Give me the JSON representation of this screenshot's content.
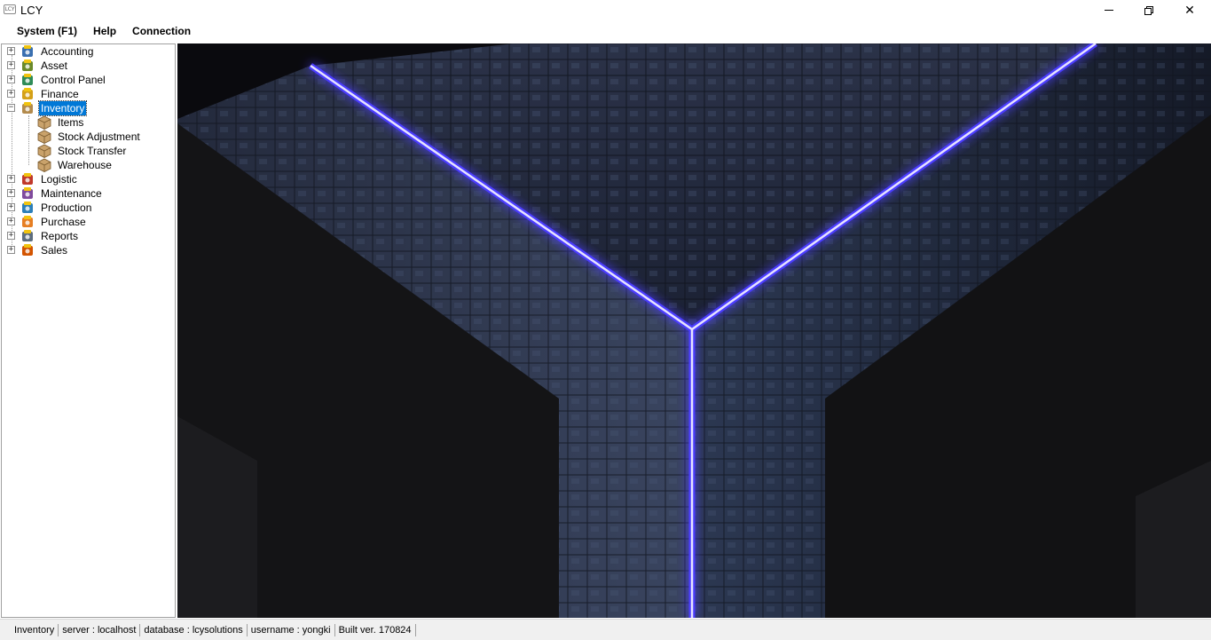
{
  "window": {
    "title": "LCY",
    "app_icon_text": "LCY",
    "minimize_icon": "minimize-icon",
    "restore_icon": "restore-icon",
    "close_icon": "close-icon"
  },
  "menu": {
    "items": [
      {
        "label": "System (F1)"
      },
      {
        "label": "Help"
      },
      {
        "label": "Connection"
      }
    ]
  },
  "tree": {
    "nodes": [
      {
        "label": "Accounting",
        "icon": "accounting-icon",
        "expander": "+"
      },
      {
        "label": "Asset",
        "icon": "asset-icon",
        "expander": "+"
      },
      {
        "label": "Control Panel",
        "icon": "control-panel-icon",
        "expander": "+"
      },
      {
        "label": "Finance",
        "icon": "finance-icon",
        "expander": "+"
      },
      {
        "label": "Inventory",
        "icon": "inventory-icon",
        "expander": "−",
        "selected": true,
        "children": [
          {
            "label": "Items",
            "icon": "box-icon"
          },
          {
            "label": "Stock Adjustment",
            "icon": "box-icon"
          },
          {
            "label": "Stock Transfer",
            "icon": "box-icon"
          },
          {
            "label": "Warehouse",
            "icon": "box-icon"
          }
        ]
      },
      {
        "label": "Logistic",
        "icon": "logistic-icon",
        "expander": "+"
      },
      {
        "label": "Maintenance",
        "icon": "maintenance-icon",
        "expander": "+"
      },
      {
        "label": "Production",
        "icon": "production-icon",
        "expander": "+"
      },
      {
        "label": "Purchase",
        "icon": "purchase-icon",
        "expander": "+"
      },
      {
        "label": "Reports",
        "icon": "reports-icon",
        "expander": "+"
      },
      {
        "label": "Sales",
        "icon": "sales-icon",
        "expander": "+"
      }
    ]
  },
  "background": {
    "description_icon": "circuit-cube-wallpaper",
    "accent_color": "#5a4dff"
  },
  "status": {
    "cells": [
      "Inventory",
      "server : localhost",
      "database : lcysolutions",
      "username : yongki",
      "Built ver. 170824"
    ]
  }
}
